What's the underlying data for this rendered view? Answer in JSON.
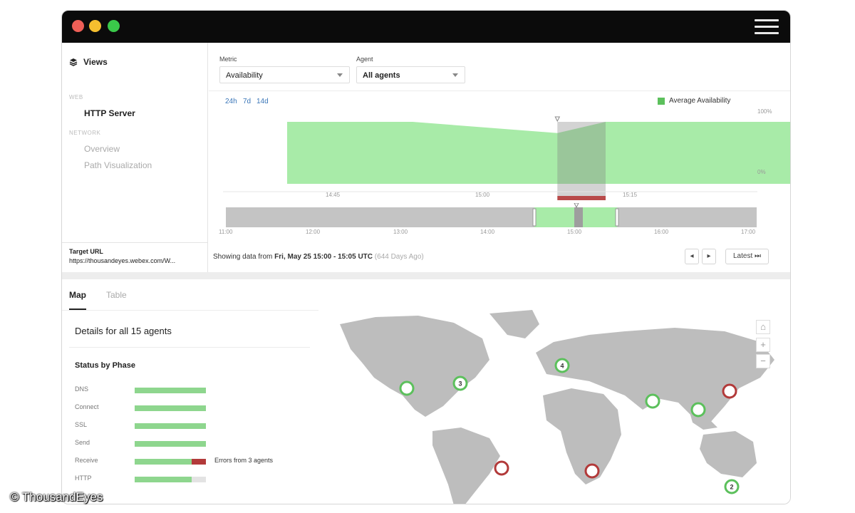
{
  "colors": {
    "accent_green": "#5cc05c",
    "error_red": "#b23a3a",
    "dot_red": "#ee5f57",
    "dot_yellow": "#f5bf2f",
    "dot_green": "#3ac94a"
  },
  "sidebar": {
    "title": "Views",
    "icon": "stack-icon",
    "section_web": "WEB",
    "item_http": "HTTP Server",
    "section_network": "NETWORK",
    "item_overview": "Overview",
    "item_path": "Path Visualization",
    "target_label": "Target URL",
    "target_value": "https://thousandeyes.webex.com/W..."
  },
  "controls": {
    "metric_label": "Metric",
    "metric_value": "Availability",
    "agent_label": "Agent",
    "agent_value": "All agents"
  },
  "timeline": {
    "ranges": [
      "24h",
      "7d",
      "14d"
    ],
    "legend": "Average Availability",
    "y_max_label": "100%",
    "y_min_label": "0%",
    "detail_ticks": [
      "14:45",
      "15:00",
      "15:15"
    ],
    "overview_ticks": [
      "11:00",
      "12:00",
      "13:00",
      "14:00",
      "15:00",
      "16:00",
      "17:00"
    ]
  },
  "chart_data": {
    "type": "area",
    "title": "",
    "series": [
      {
        "name": "Average Availability",
        "x": [
          "14:32",
          "14:45",
          "15:00",
          "15:05",
          "15:15",
          "15:27"
        ],
        "values": [
          100,
          100,
          82,
          100,
          100,
          100
        ]
      }
    ],
    "ylim": [
      0,
      100
    ],
    "selected_range": [
      "15:00",
      "15:05"
    ]
  },
  "footer": {
    "prefix": "Showing data from",
    "range": "Fri, May 25 15:00 - 15:05 UTC",
    "ago": "(644 Days Ago)",
    "prev": "◂",
    "next": "▸",
    "latest": "Latest ⏭"
  },
  "tabs": {
    "map": "Map",
    "table": "Table"
  },
  "details": {
    "title": "Details for all 15 agents",
    "phase_title": "Status by Phase",
    "phases": [
      {
        "name": "DNS",
        "ok": 1.0,
        "err": 0
      },
      {
        "name": "Connect",
        "ok": 1.0,
        "err": 0
      },
      {
        "name": "SSL",
        "ok": 1.0,
        "err": 0
      },
      {
        "name": "Send",
        "ok": 1.0,
        "err": 0
      },
      {
        "name": "Receive",
        "ok": 0.8,
        "err": 0.2
      },
      {
        "name": "HTTP",
        "ok": 0.8,
        "err": 0
      }
    ],
    "receive_note": "Errors from 3 agents"
  },
  "map": {
    "zoom_reset": "⌂",
    "zoom_in": "+",
    "zoom_out": "−",
    "markers": [
      {
        "label": "",
        "status": "ok"
      },
      {
        "label": "3",
        "status": "ok"
      },
      {
        "label": "4",
        "status": "ok"
      },
      {
        "label": "",
        "status": "ok"
      },
      {
        "label": "",
        "status": "ok"
      },
      {
        "label": "",
        "status": "error"
      },
      {
        "label": "",
        "status": "error"
      },
      {
        "label": "",
        "status": "error"
      },
      {
        "label": "2",
        "status": "ok"
      }
    ]
  },
  "watermark": "© ThousandEyes"
}
